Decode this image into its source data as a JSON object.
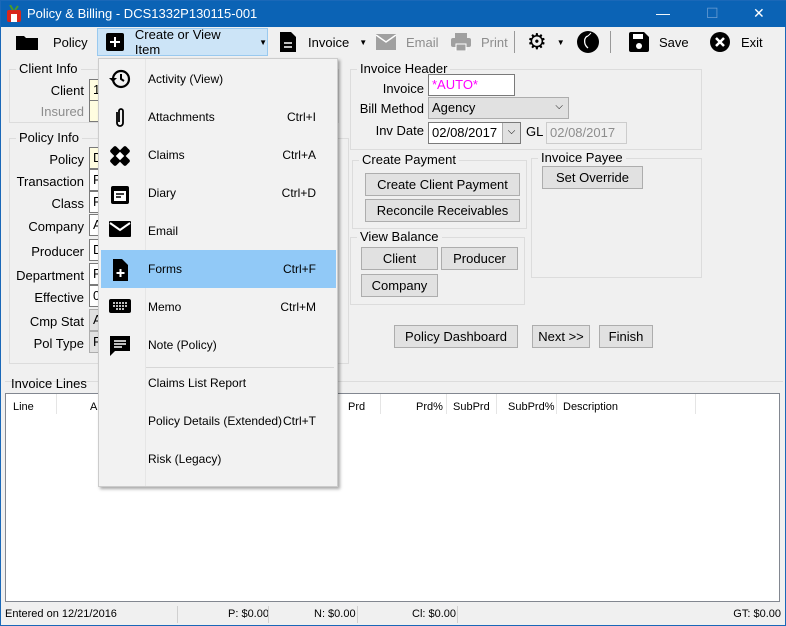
{
  "window": {
    "title": "Policy & Billing - DCS1332P130115-001",
    "minimize": "—",
    "maximize": "☐",
    "close": "✕"
  },
  "toolbar": {
    "policy": "Policy",
    "create": "Create or View Item",
    "invoice": "Invoice",
    "email": "Email",
    "print": "Print",
    "save": "Save",
    "exit": "Exit"
  },
  "client_info": {
    "title": "Client Info",
    "client_label": "Client",
    "client_value": "1",
    "insured_label": "Insured"
  },
  "policy_info": {
    "title": "Policy Info",
    "fields": [
      {
        "label": "Policy",
        "value": "D"
      },
      {
        "label": "Transaction",
        "value": "P"
      },
      {
        "label": "Class",
        "value": "P"
      },
      {
        "label": "Company",
        "value": "A"
      },
      {
        "label": "Producer",
        "value": "D"
      },
      {
        "label": "Department",
        "value": "P"
      },
      {
        "label": "Effective",
        "value": "0"
      },
      {
        "label": "Cmp Stat",
        "value": "A"
      },
      {
        "label": "Pol Type",
        "value": "P"
      }
    ]
  },
  "invoice_header": {
    "title": "Invoice Header",
    "invoice_label": "Invoice",
    "invoice_value": "*AUTO*",
    "invoice_color": "#ff00ff",
    "bill_method_label": "Bill Method",
    "bill_method_value": "Agency",
    "inv_date_label": "Inv Date",
    "inv_date_value": "02/08/2017",
    "gl_label": "GL",
    "gl_value": "02/08/2017"
  },
  "create_payment": {
    "title": "Create Payment",
    "create_client_payment": "Create Client Payment",
    "reconcile": "Reconcile Receivables"
  },
  "invoice_payee": {
    "title": "Invoice Payee",
    "set_override": "Set Override"
  },
  "view_balance": {
    "title": "View Balance",
    "client": "Client",
    "producer": "Producer",
    "company": "Company"
  },
  "nav": {
    "dashboard": "Policy Dashboard",
    "next": "Next >>",
    "finish": "Finish"
  },
  "menu": {
    "items": [
      {
        "label": "Activity (View)",
        "shortcut": "",
        "icon": "history-icon"
      },
      {
        "label": "Attachments",
        "shortcut": "Ctrl+I",
        "icon": "paperclip-icon"
      },
      {
        "label": "Claims",
        "shortcut": "Ctrl+A",
        "icon": "bandage-icon"
      },
      {
        "label": "Diary",
        "shortcut": "Ctrl+D",
        "icon": "calendar-icon"
      },
      {
        "label": "Email",
        "shortcut": "",
        "icon": "envelope-icon"
      },
      {
        "label": "Forms",
        "shortcut": "Ctrl+F",
        "icon": "file-plus-icon",
        "highlighted": true
      },
      {
        "label": "Memo",
        "shortcut": "Ctrl+M",
        "icon": "keyboard-icon"
      },
      {
        "label": "Note (Policy)",
        "shortcut": "",
        "icon": "comment-icon"
      },
      {
        "label": "Claims List Report",
        "shortcut": ""
      },
      {
        "label": "Policy Details (Extended)",
        "shortcut": "Ctrl+T"
      },
      {
        "label": "Risk (Legacy)",
        "shortcut": ""
      }
    ],
    "highlight_color": "#91c9f7"
  },
  "invoice_lines": {
    "title": "Invoice Lines",
    "columns": [
      "Line",
      "A",
      "Prd",
      "Prd%",
      "SubPrd",
      "SubPrd%",
      "Description"
    ],
    "rows": []
  },
  "status": {
    "entered": "Entered on 12/21/2016",
    "p": "P: $0.00",
    "n": "N: $0.00",
    "cl": "Cl: $0.00",
    "gt": "GT: $0.00"
  }
}
